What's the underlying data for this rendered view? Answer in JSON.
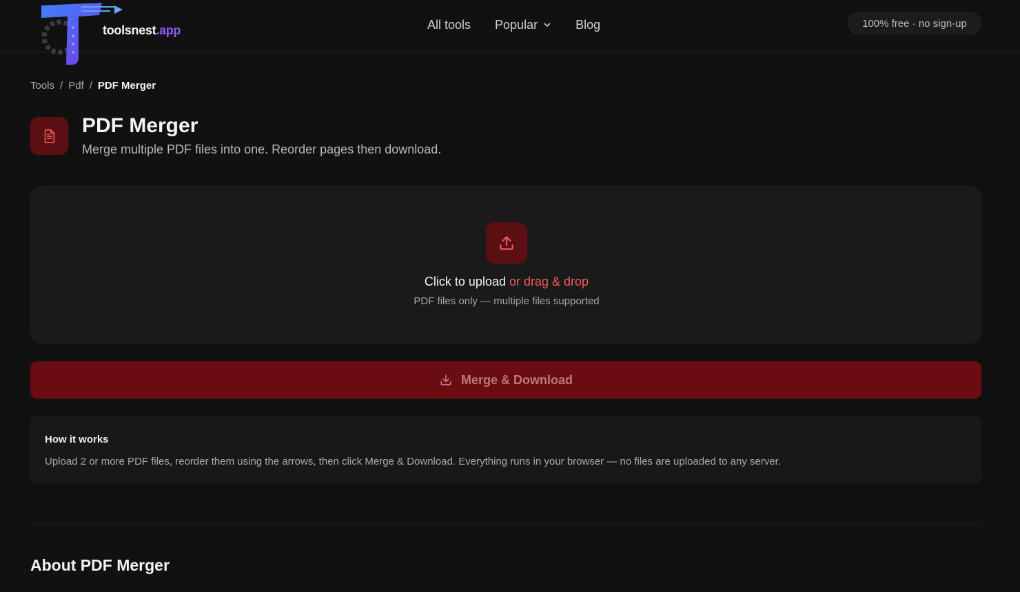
{
  "header": {
    "logo_name": "toolsnest",
    "logo_tld": ".app",
    "nav": [
      {
        "label": "All tools"
      },
      {
        "label": "Popular"
      },
      {
        "label": "Blog"
      }
    ],
    "badge": "100% free · no sign-up"
  },
  "breadcrumb": {
    "items": [
      "Tools",
      "Pdf",
      "PDF Merger"
    ],
    "separator": "/"
  },
  "page": {
    "title": "PDF Merger",
    "subtitle": "Merge multiple PDF files into one. Reorder pages then download."
  },
  "upload": {
    "main_text": "Click to upload",
    "accent_text": "or drag & drop",
    "sub_text": "PDF files only — multiple files supported"
  },
  "merge_button": {
    "label": "Merge & Download"
  },
  "how_it_works": {
    "title": "How it works",
    "text": "Upload 2 or more PDF files, reorder them using the arrows, then click Merge & Download. Everything runs in your browser — no files are uploaded to any server."
  },
  "about": {
    "title": "About PDF Merger"
  },
  "colors": {
    "background": "#111111",
    "accent_red": "#f05a5a",
    "button_red": "#6b0c12",
    "brand_purple": "#8b5cf6"
  },
  "icons": {
    "title_icon": "document-icon",
    "upload_icon": "upload-icon",
    "merge_icon": "download-icon",
    "popular_caret": "chevron-down-icon"
  }
}
